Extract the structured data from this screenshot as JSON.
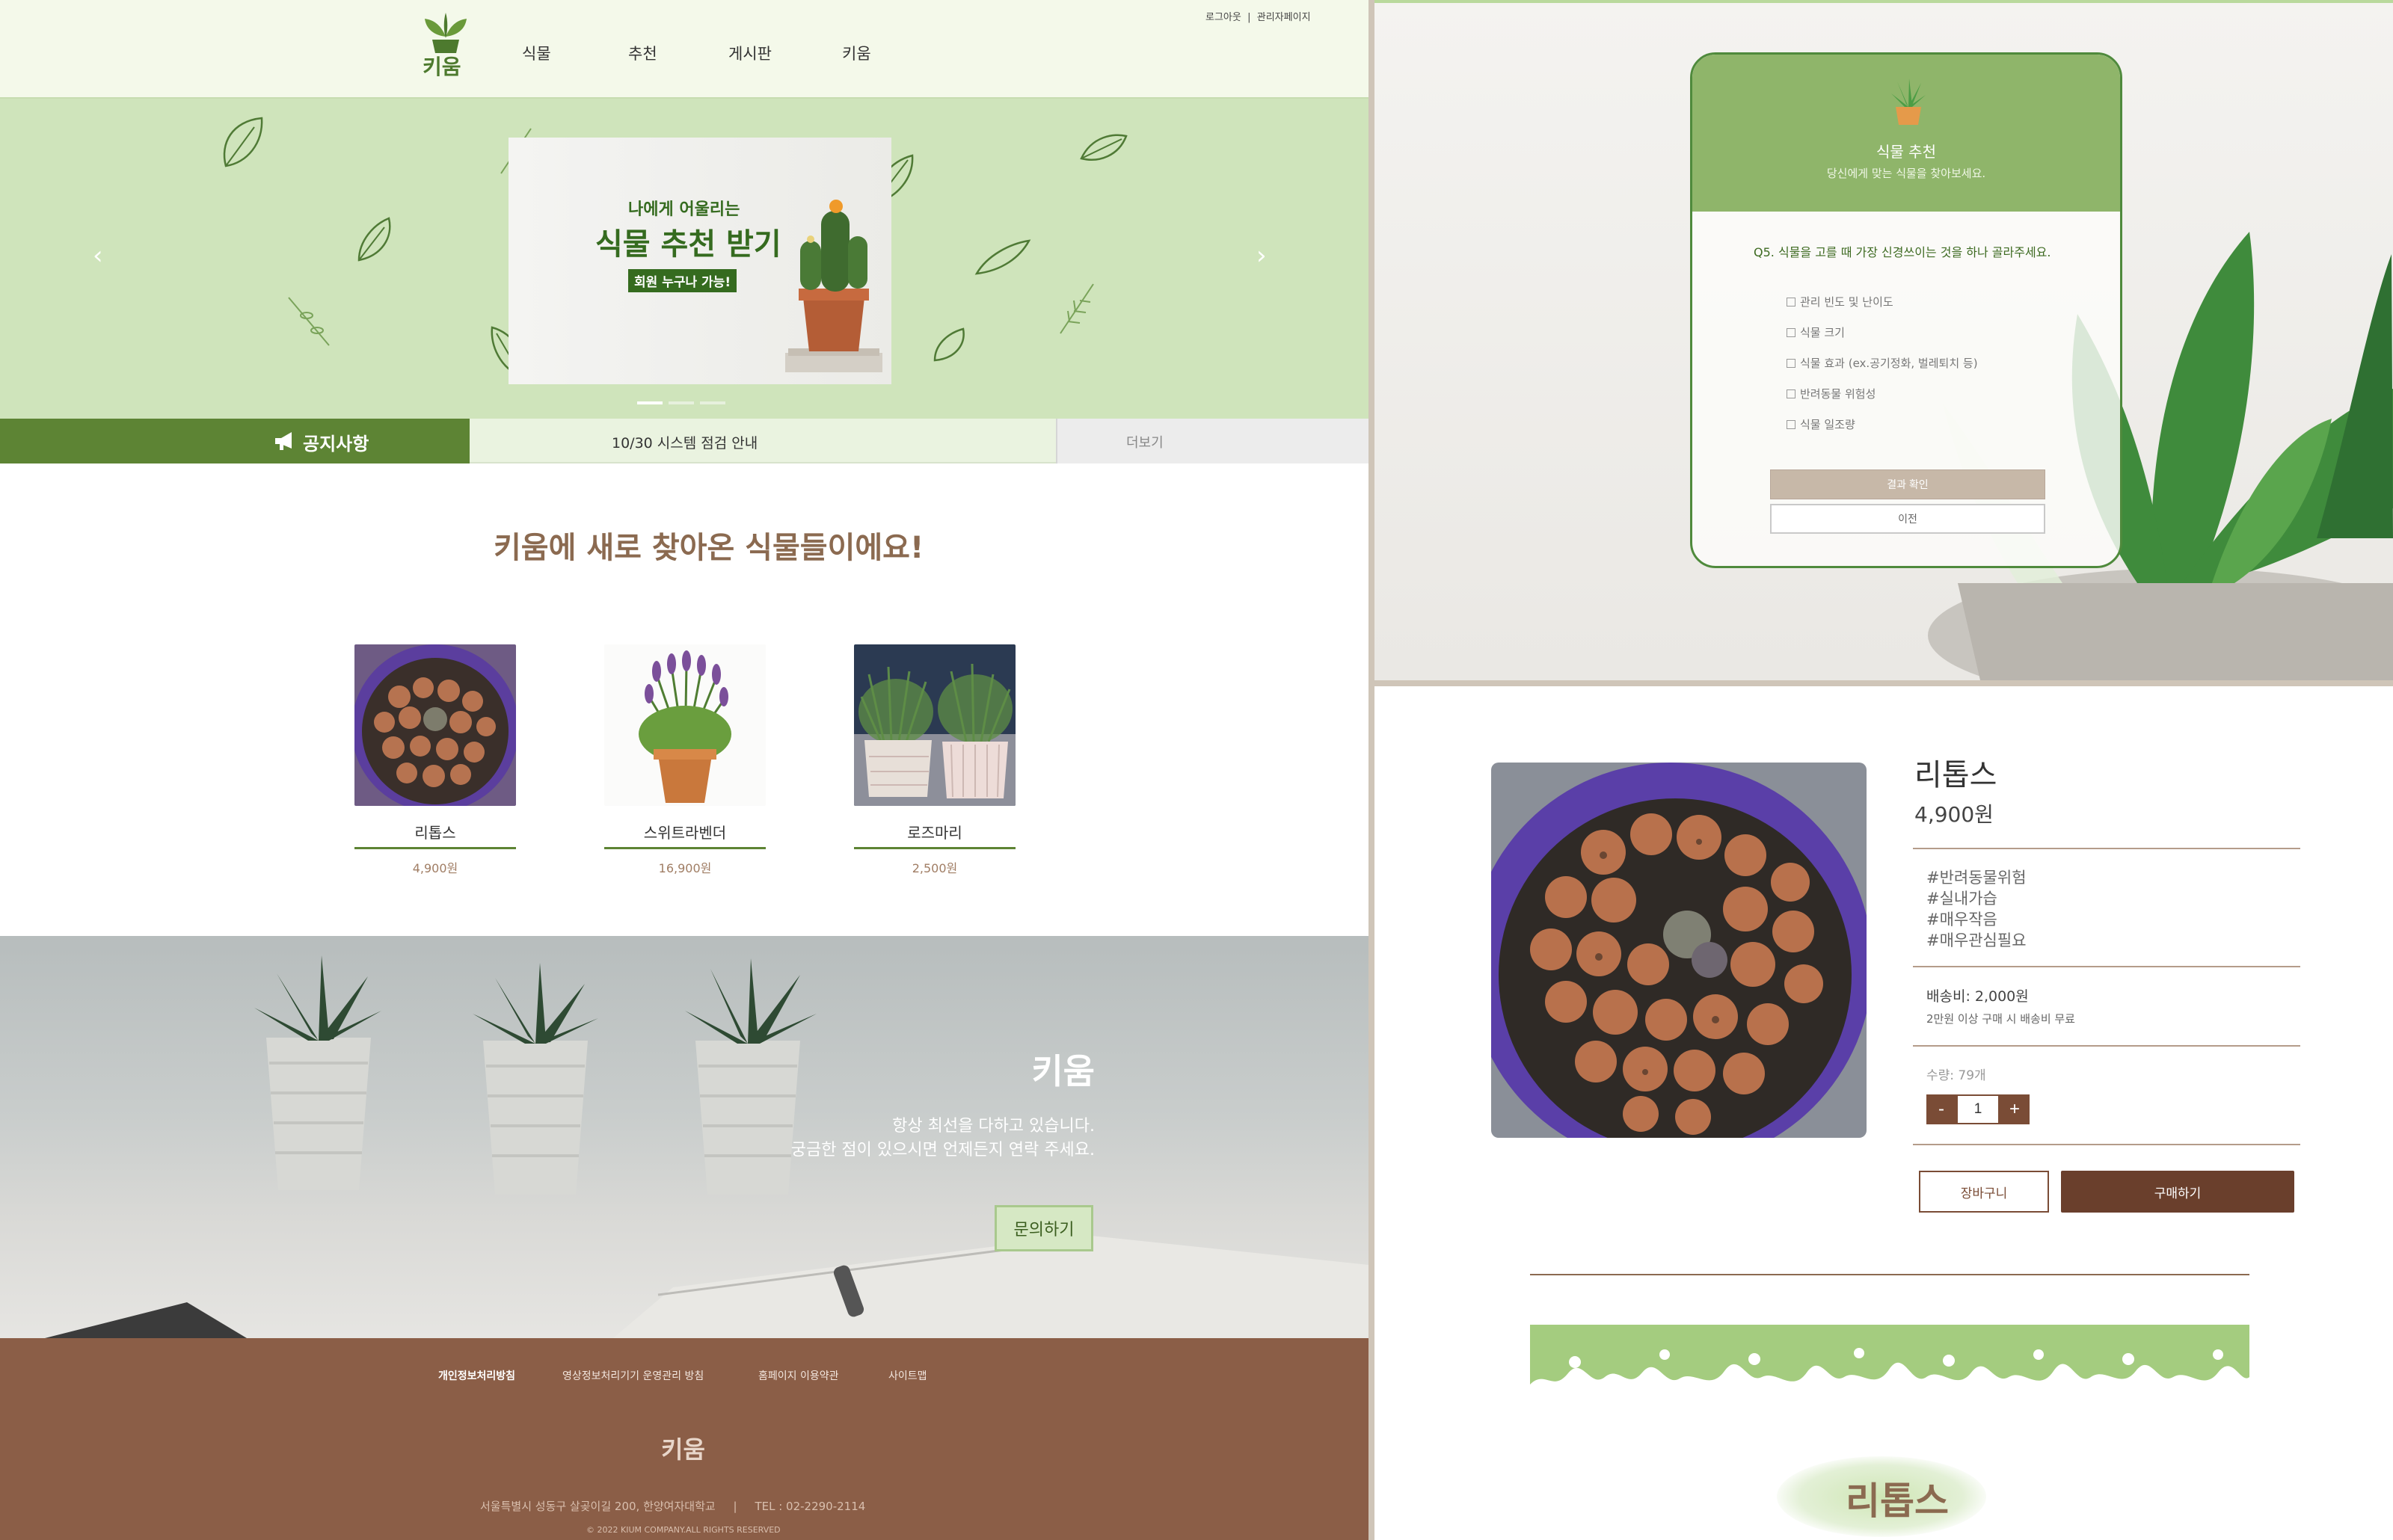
{
  "header": {
    "logo_text": "키움",
    "nav": [
      "식물",
      "추천",
      "게시판",
      "키움"
    ],
    "login": "로그아웃",
    "admin": "관리자페이지"
  },
  "hero": {
    "line1": "나에게 어울리는",
    "line2": "식물 추천 받기",
    "line3": "회원 누구나 가능!",
    "slides": 3,
    "active_slide": 1
  },
  "notice": {
    "label": "공지사항",
    "text": "10/30 시스템 점검 안내",
    "more": "더보기"
  },
  "new_plants": {
    "title": "키움에 새로 찾아온 식물들이에요!",
    "items": [
      {
        "name": "리톱스",
        "price": "4,900원"
      },
      {
        "name": "스위트라벤더",
        "price": "16,900원"
      },
      {
        "name": "로즈마리",
        "price": "2,500원"
      }
    ]
  },
  "contact": {
    "title": "키움",
    "line1": "항상 최선을 다하고 있습니다.",
    "line2": "궁금한 점이 있으시면 언제든지 연락 주세요.",
    "button": "문의하기"
  },
  "footer": {
    "links": [
      "개인정보처리방침",
      "영상정보처리기기 운영관리 방침",
      "홈페이지 이용약관",
      "사이트맵"
    ],
    "logo": "키움",
    "address": "서울특별시 성동구 살곶이길 200, 한양여자대학교",
    "tel": "TEL : 02-2290-2114",
    "copyright": "© 2022 KIUM COMPANY.ALL RIGHTS RESERVED"
  },
  "quiz": {
    "title": "식물 추천",
    "subtitle": "당신에게 맞는 식물을 찾아보세요.",
    "question": "Q5. 식물을 고를 때 가장 신경쓰이는 것을 하나 골라주세요.",
    "options": [
      "관리 빈도 및 난이도",
      "식물 크기",
      "식물 효과 (ex.공기정화, 벌레퇴치 등)",
      "반려동물 위험성",
      "식물 일조량"
    ],
    "submit": "결과 확인",
    "prev": "이전"
  },
  "product": {
    "name": "리톱스",
    "price": "4,900원",
    "tags": [
      "#반려동물위험",
      "#실내가습",
      "#매우작음",
      "#매우관심필요"
    ],
    "shipping": "배송비: 2,000원",
    "shipping_note": "2만원 이상 구매 시 배송비 무료",
    "stock": "수량: 79개",
    "quantity": "1",
    "minus": "-",
    "plus": "+",
    "cart": "장바구니",
    "buy": "구매하기",
    "section_title": "리톱스"
  },
  "colors": {
    "brand_green": "#5d8434",
    "light_green": "#cfe4bb",
    "brown": "#8b5e47",
    "dark_brown": "#6a3f2c"
  }
}
